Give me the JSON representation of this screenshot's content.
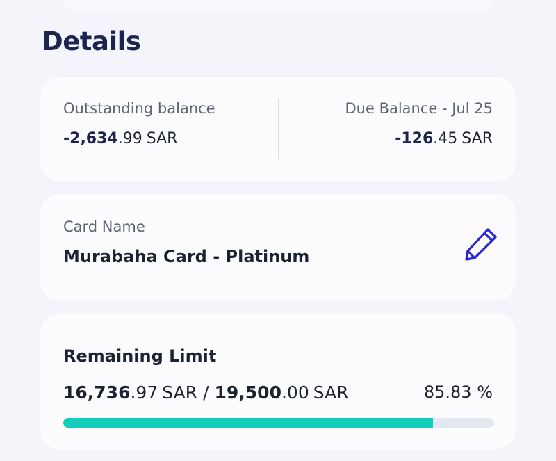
{
  "page": {
    "title": "Details"
  },
  "balances": {
    "outstanding": {
      "label": "Outstanding balance",
      "int": "-2,634",
      "dec": ".99",
      "currency": "SAR"
    },
    "due": {
      "label": "Due Balance - Jul 25",
      "int": "-126",
      "dec": ".45",
      "currency": "SAR"
    }
  },
  "card_name": {
    "label": "Card Name",
    "value": "Murabaha Card - Platinum",
    "edit_icon": "pencil-icon"
  },
  "limit": {
    "title": "Remaining Limit",
    "remaining_int": "16,736",
    "remaining_dec": ".97",
    "total_int": "19,500",
    "total_dec": ".00",
    "currency": "SAR",
    "separator": "/",
    "percent_text": "85.83 %",
    "progress_fraction": 0.8583
  },
  "colors": {
    "accent": "#12cdb9",
    "title": "#1c2450",
    "icon": "#2727d6",
    "track": "#e4e8f1"
  }
}
